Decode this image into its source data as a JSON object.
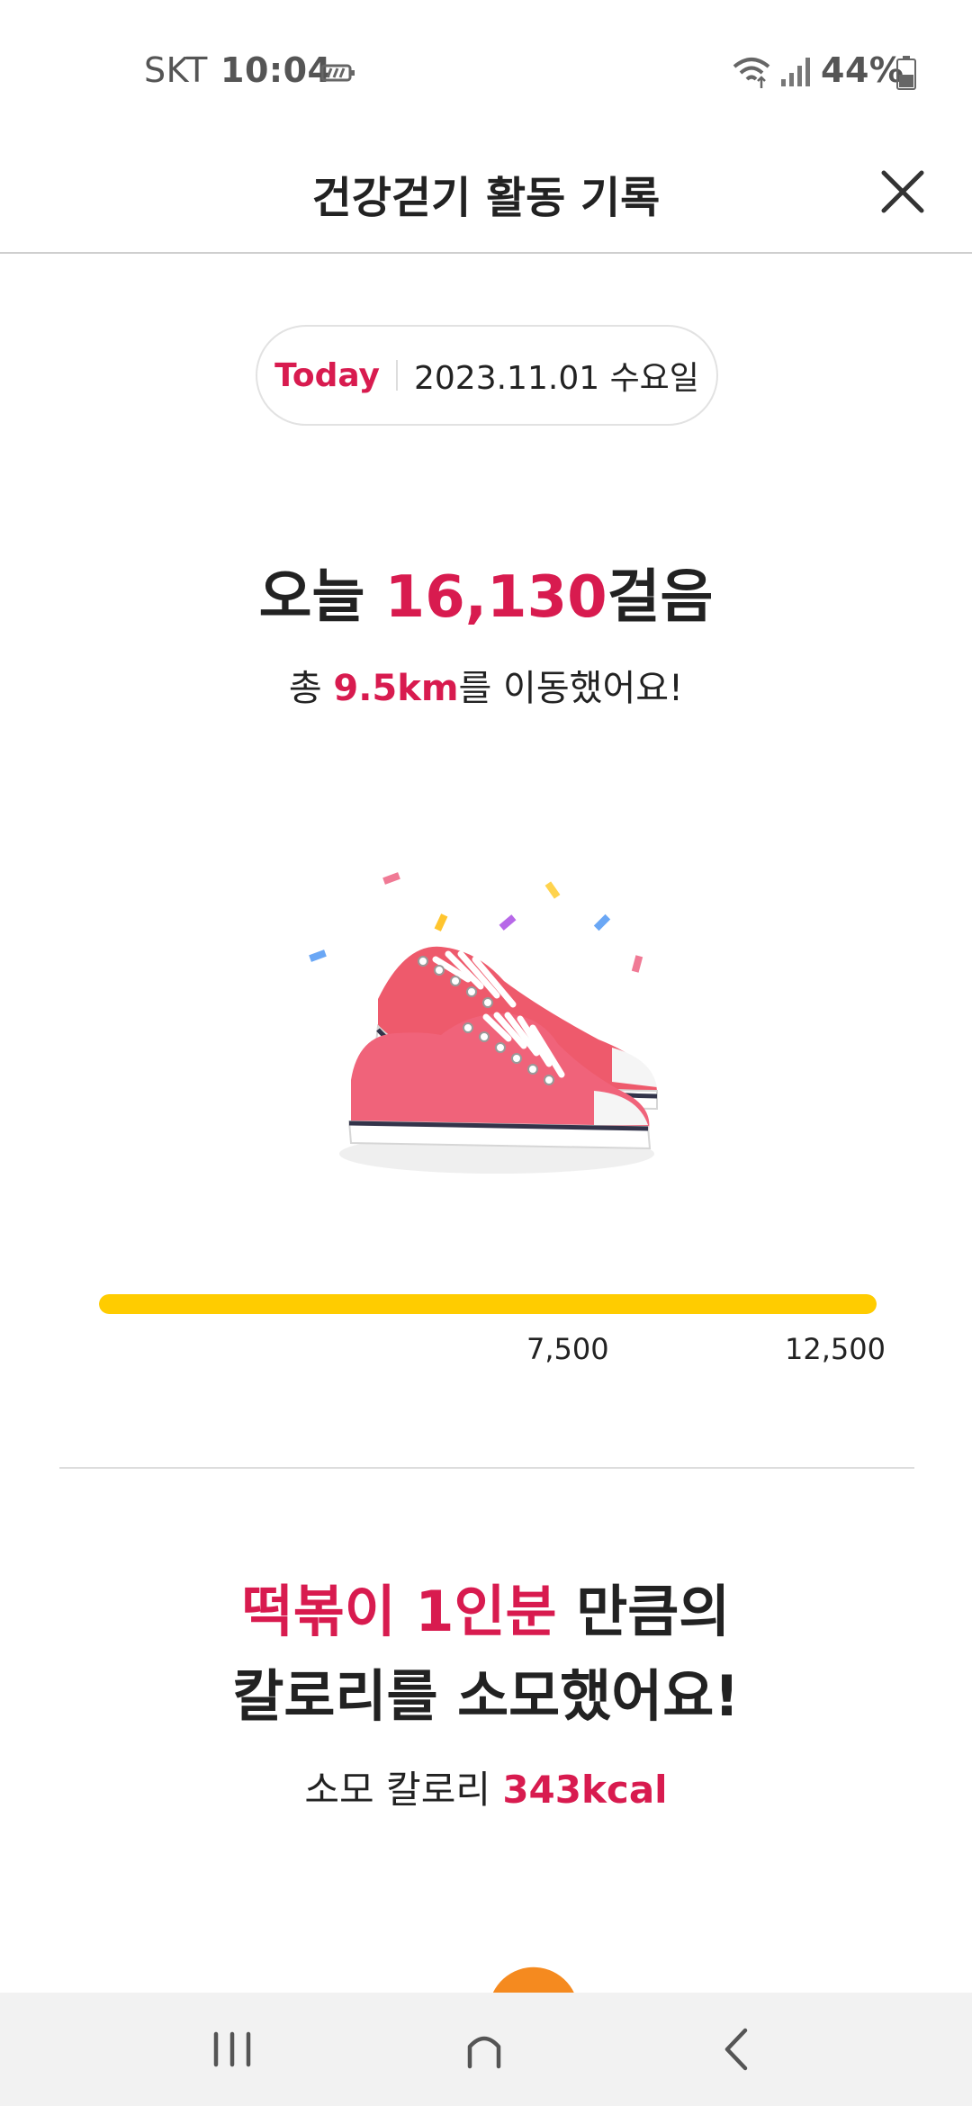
{
  "status_bar": {
    "carrier": "SKT",
    "time": "10:04",
    "battery_percent": "44%",
    "icons": [
      "battery-saver-icon",
      "wifi-icon",
      "signal-icon",
      "battery-icon"
    ]
  },
  "header": {
    "title": "건강걷기 활동 기록",
    "close_icon": "close-icon"
  },
  "date_pill": {
    "today_label": "Today",
    "date": "2023.11.01 수요일"
  },
  "steps": {
    "prefix": "오늘 ",
    "count": "16,130",
    "suffix": "걸음"
  },
  "distance": {
    "prefix": "총 ",
    "value": "9.5km",
    "suffix": "를 이동했어요!"
  },
  "illustration": {
    "icon": "sneakers-illustration"
  },
  "progress": {
    "fraction": 1.0,
    "labels": [
      "7,500",
      "12,500"
    ],
    "color": "#ffcc00"
  },
  "calorie": {
    "headline_highlight": "떡볶이 1인분",
    "headline_rest": " 만큼의",
    "headline_line2": "칼로리를 소모했어요!",
    "label": "소모 칼로리 ",
    "value": "343kcal"
  },
  "nav": {
    "icons": [
      "recent-apps-icon",
      "home-icon",
      "back-icon"
    ]
  },
  "colors": {
    "accent": "#d81b4f",
    "progress": "#ffcc00",
    "nav_background": "#f2f2f2"
  }
}
